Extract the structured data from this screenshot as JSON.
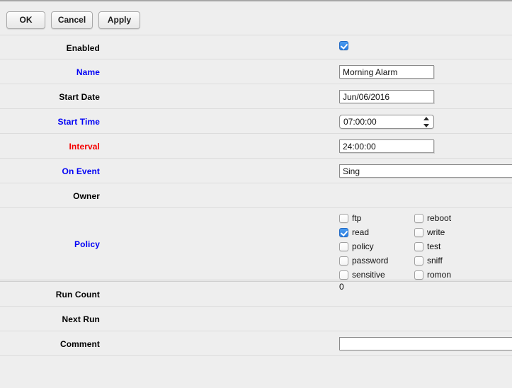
{
  "toolbar": {
    "ok_label": "OK",
    "cancel_label": "Cancel",
    "apply_label": "Apply"
  },
  "form": {
    "enabled": {
      "label": "Enabled",
      "checked": true
    },
    "name": {
      "label": "Name",
      "value": "Morning Alarm",
      "label_color": "#0000f5"
    },
    "start_date": {
      "label": "Start Date",
      "value": "Jun/06/2016"
    },
    "start_time": {
      "label": "Start Time",
      "value": "07:00:00",
      "label_color": "#0000f5"
    },
    "interval": {
      "label": "Interval",
      "value": "24:00:00",
      "label_color": "#f50000"
    },
    "on_event": {
      "label": "On Event",
      "value": "Sing",
      "label_color": "#0000f5"
    },
    "owner": {
      "label": "Owner",
      "value": ""
    },
    "policy": {
      "label": "Policy",
      "label_color": "#0000f5",
      "left_column": [
        {
          "name": "ftp",
          "checked": false
        },
        {
          "name": "read",
          "checked": true
        },
        {
          "name": "policy",
          "checked": false
        },
        {
          "name": "password",
          "checked": false
        },
        {
          "name": "sensitive",
          "checked": false
        }
      ],
      "right_column": [
        {
          "name": "reboot",
          "checked": false
        },
        {
          "name": "write",
          "checked": false
        },
        {
          "name": "test",
          "checked": false
        },
        {
          "name": "sniff",
          "checked": false
        },
        {
          "name": "romon",
          "checked": false
        }
      ]
    },
    "run_count": {
      "label": "Run Count",
      "value": "0"
    },
    "next_run": {
      "label": "Next Run",
      "value": ""
    },
    "comment": {
      "label": "Comment",
      "value": "",
      "placeholder": ""
    }
  },
  "colors": {
    "background": "#eeeeee",
    "separator": "#dcdcdc",
    "accent_blue": "#0000f5",
    "accent_red": "#f50000",
    "checkbox_on": "#2d7fe0"
  }
}
